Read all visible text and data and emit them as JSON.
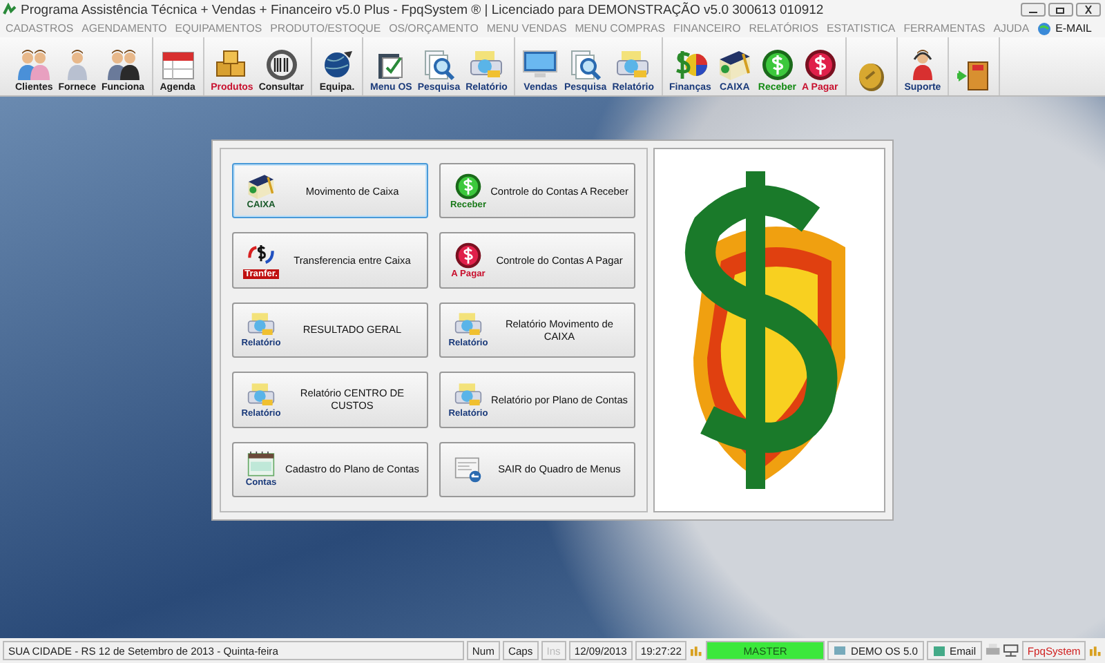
{
  "window": {
    "title": "Programa Assistência Técnica + Vendas + Financeiro v5.0 Plus - FpqSystem ® | Licenciado para  DEMONSTRAÇÃO v5.0 300613 010912"
  },
  "menu": [
    {
      "label": "CADASTROS",
      "kind": "text"
    },
    {
      "label": "AGENDAMENTO",
      "kind": "text"
    },
    {
      "label": "EQUIPAMENTOS",
      "kind": "text"
    },
    {
      "label": "PRODUTO/ESTOQUE",
      "kind": "text"
    },
    {
      "label": "OS/ORÇAMENTO",
      "kind": "text"
    },
    {
      "label": "MENU VENDAS",
      "kind": "text"
    },
    {
      "label": "MENU COMPRAS",
      "kind": "text"
    },
    {
      "label": "FINANCEIRO",
      "kind": "text"
    },
    {
      "label": "RELATÓRIOS",
      "kind": "text"
    },
    {
      "label": "ESTATISTICA",
      "kind": "text"
    },
    {
      "label": "FERRAMENTAS",
      "kind": "text"
    },
    {
      "label": "AJUDA",
      "kind": "text"
    },
    {
      "label": "E-MAIL",
      "kind": "email"
    }
  ],
  "toolbar": [
    {
      "items": [
        {
          "kind": "labeled",
          "label": "Clientes",
          "color": "#1a1a1a"
        },
        {
          "kind": "labeled",
          "label": "Fornece",
          "color": "#1a1a1a"
        },
        {
          "kind": "labeled",
          "label": "Funciona",
          "color": "#1a1a1a"
        }
      ]
    },
    {
      "items": [
        {
          "kind": "labeled",
          "label": "Agenda",
          "color": "#1a1a1a"
        }
      ]
    },
    {
      "items": [
        {
          "kind": "labeled",
          "label": "Produtos",
          "color": "#c8102e"
        },
        {
          "kind": "labeled",
          "label": "Consultar",
          "color": "#1a1a1a"
        }
      ]
    },
    {
      "items": [
        {
          "kind": "labeled",
          "label": "Equipa.",
          "color": "#1a1a1a"
        }
      ]
    },
    {
      "items": [
        {
          "kind": "labeled",
          "label": "Menu OS",
          "color": "#1a3a7a"
        },
        {
          "kind": "labeled",
          "label": "Pesquisa",
          "color": "#1a3a7a"
        },
        {
          "kind": "labeled",
          "label": "Relatório",
          "color": "#1a3a7a"
        }
      ]
    },
    {
      "items": [
        {
          "kind": "labeled",
          "label": "Vendas",
          "color": "#1a3a7a"
        },
        {
          "kind": "labeled",
          "label": "Pesquisa",
          "color": "#1a3a7a"
        },
        {
          "kind": "labeled",
          "label": "Relatório",
          "color": "#1a3a7a"
        }
      ]
    },
    {
      "items": [
        {
          "kind": "labeled",
          "label": "Finanças",
          "color": "#1a3a7a"
        },
        {
          "kind": "labeled",
          "label": "CAIXA",
          "color": "#1a3a7a"
        },
        {
          "kind": "labeled",
          "label": "Receber",
          "color": "#138a13"
        },
        {
          "kind": "labeled",
          "label": "A Pagar",
          "color": "#c8102e"
        }
      ]
    },
    {
      "items": [
        {
          "kind": "icon"
        }
      ]
    },
    {
      "items": [
        {
          "kind": "labeled",
          "label": "Suporte",
          "color": "#1a3a7a"
        }
      ]
    },
    {
      "items": [
        {
          "kind": "icon"
        }
      ]
    }
  ],
  "panel": {
    "buttons": [
      {
        "label": "Movimento de Caixa",
        "badge": "CAIXA",
        "selected": true
      },
      {
        "label": "Controle do Contas A Receber",
        "badge": "Receber",
        "selected": false
      },
      {
        "label": "Transferencia entre Caixa",
        "badge": "Tranfer.",
        "selected": false
      },
      {
        "label": "Controle do Contas A Pagar",
        "badge": "A Pagar",
        "selected": false
      },
      {
        "label": "RESULTADO GERAL",
        "badge": "Relatório",
        "selected": false
      },
      {
        "label": "Relatório Movimento de CAIXA",
        "badge": "Relatório",
        "selected": false
      },
      {
        "label": "Relatório CENTRO DE CUSTOS",
        "badge": "Relatório",
        "selected": false
      },
      {
        "label": "Relatório por Plano de Contas",
        "badge": "Relatório",
        "selected": false
      },
      {
        "label": "Cadastro do Plano de Contas",
        "badge": "Contas",
        "selected": false
      },
      {
        "label": "SAIR do Quadro de Menus",
        "selected": false
      }
    ]
  },
  "status_bar": {
    "location": "SUA CIDADE - RS 12 de Setembro de 2013 - Quinta-feira",
    "keys": [
      {
        "label": "Num",
        "disabled": false
      },
      {
        "label": "Caps",
        "disabled": false
      },
      {
        "label": "Ins",
        "disabled": true
      }
    ],
    "date": "12/09/2013",
    "time": "19:27:22",
    "user": "MASTER",
    "system": "DEMO OS 5.0",
    "email": "Email",
    "brand": "FpqSystem"
  }
}
